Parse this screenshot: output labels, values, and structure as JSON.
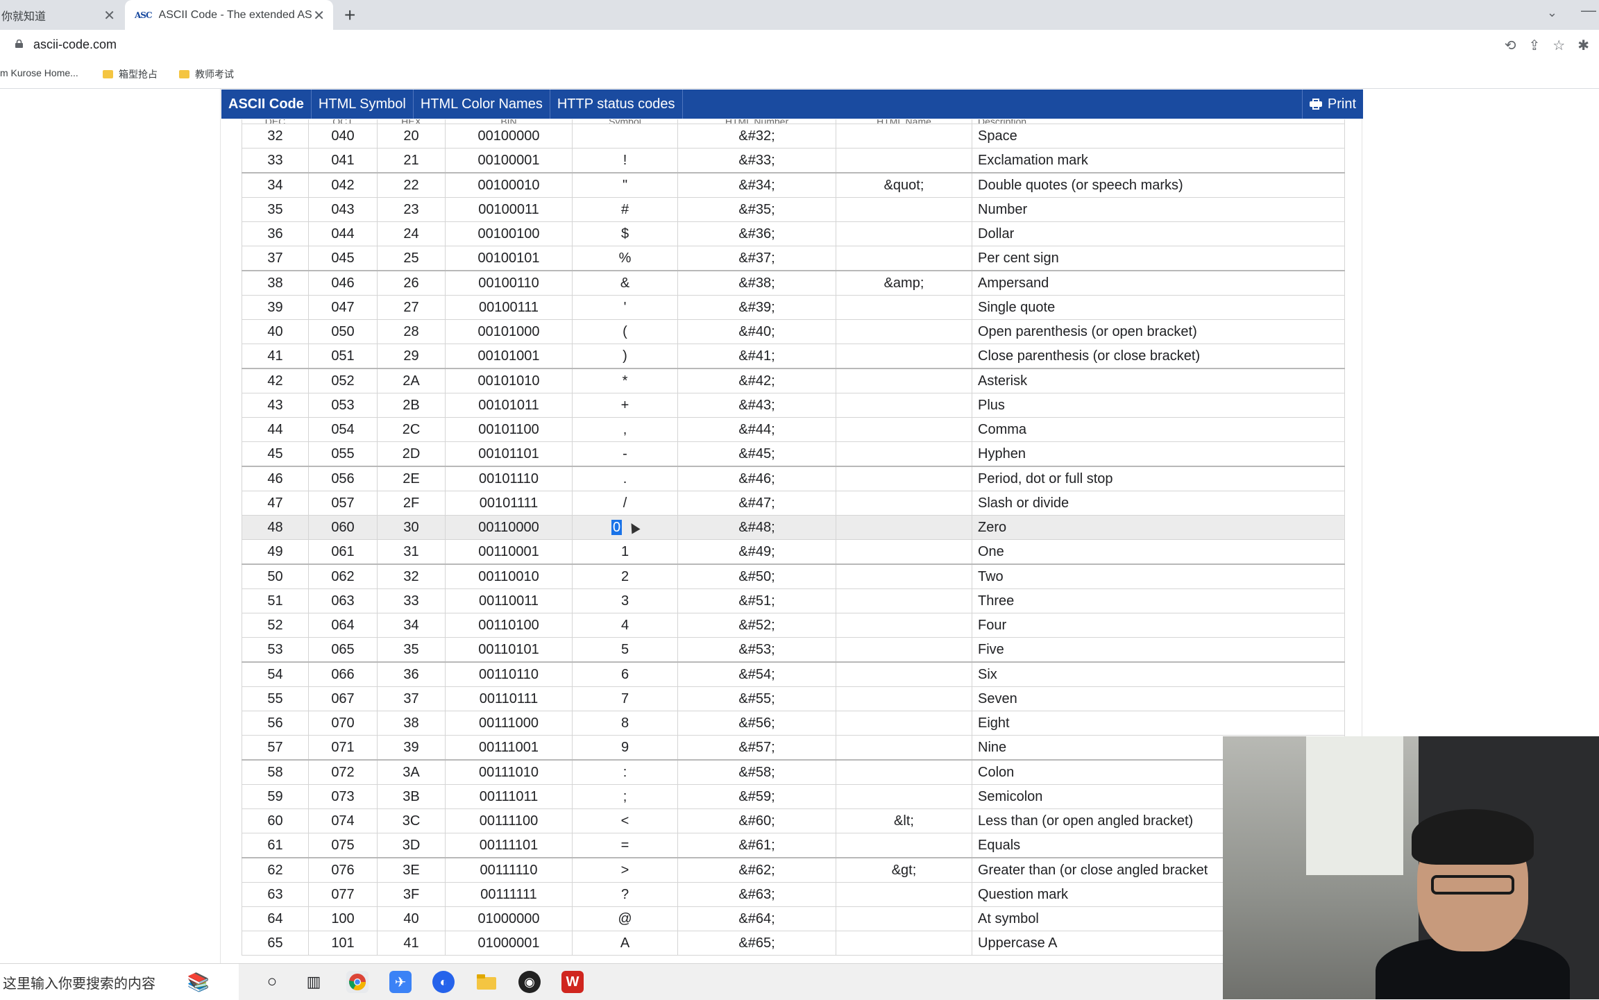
{
  "browser": {
    "tabs": [
      {
        "title": "你就知道",
        "active": false
      },
      {
        "title": "ASCII Code - The extended AS",
        "active": true
      }
    ],
    "favicon_text": "ASC",
    "url": "ascii-code.com",
    "bookmarks": [
      {
        "label": "m Kurose Home..."
      },
      {
        "label": "箱型抢占"
      },
      {
        "label": "教师考试"
      }
    ]
  },
  "site_nav": {
    "brand": "ASCII Code",
    "items": [
      "HTML Symbol",
      "HTML Color Names",
      "HTTP status codes"
    ],
    "print": "Print"
  },
  "table": {
    "header_partial": [
      "DEC",
      "OCT",
      "HEX",
      "BIN",
      "Symbol",
      "HTML Number",
      "HTML Name",
      "Description"
    ],
    "rows": [
      {
        "dec": "32",
        "oct": "040",
        "hex": "20",
        "bin": "00100000",
        "sym": "",
        "num": "&#32;",
        "name": "",
        "desc": "Space"
      },
      {
        "dec": "33",
        "oct": "041",
        "hex": "21",
        "bin": "00100001",
        "sym": "!",
        "num": "&#33;",
        "name": "",
        "desc": "Exclamation mark"
      },
      {
        "dec": "34",
        "oct": "042",
        "hex": "22",
        "bin": "00100010",
        "sym": "\"",
        "num": "&#34;",
        "name": "&quot;",
        "desc": "Double quotes (or speech marks)"
      },
      {
        "dec": "35",
        "oct": "043",
        "hex": "23",
        "bin": "00100011",
        "sym": "#",
        "num": "&#35;",
        "name": "",
        "desc": "Number"
      },
      {
        "dec": "36",
        "oct": "044",
        "hex": "24",
        "bin": "00100100",
        "sym": "$",
        "num": "&#36;",
        "name": "",
        "desc": "Dollar"
      },
      {
        "dec": "37",
        "oct": "045",
        "hex": "25",
        "bin": "00100101",
        "sym": "%",
        "num": "&#37;",
        "name": "",
        "desc": "Per cent sign"
      },
      {
        "dec": "38",
        "oct": "046",
        "hex": "26",
        "bin": "00100110",
        "sym": "&",
        "num": "&#38;",
        "name": "&amp;",
        "desc": "Ampersand"
      },
      {
        "dec": "39",
        "oct": "047",
        "hex": "27",
        "bin": "00100111",
        "sym": "'",
        "num": "&#39;",
        "name": "",
        "desc": "Single quote"
      },
      {
        "dec": "40",
        "oct": "050",
        "hex": "28",
        "bin": "00101000",
        "sym": "(",
        "num": "&#40;",
        "name": "",
        "desc": "Open parenthesis (or open bracket)"
      },
      {
        "dec": "41",
        "oct": "051",
        "hex": "29",
        "bin": "00101001",
        "sym": ")",
        "num": "&#41;",
        "name": "",
        "desc": "Close parenthesis (or close bracket)"
      },
      {
        "dec": "42",
        "oct": "052",
        "hex": "2A",
        "bin": "00101010",
        "sym": "*",
        "num": "&#42;",
        "name": "",
        "desc": "Asterisk"
      },
      {
        "dec": "43",
        "oct": "053",
        "hex": "2B",
        "bin": "00101011",
        "sym": "+",
        "num": "&#43;",
        "name": "",
        "desc": "Plus"
      },
      {
        "dec": "44",
        "oct": "054",
        "hex": "2C",
        "bin": "00101100",
        "sym": ",",
        "num": "&#44;",
        "name": "",
        "desc": "Comma"
      },
      {
        "dec": "45",
        "oct": "055",
        "hex": "2D",
        "bin": "00101101",
        "sym": "-",
        "num": "&#45;",
        "name": "",
        "desc": "Hyphen"
      },
      {
        "dec": "46",
        "oct": "056",
        "hex": "2E",
        "bin": "00101110",
        "sym": ".",
        "num": "&#46;",
        "name": "",
        "desc": "Period, dot or full stop"
      },
      {
        "dec": "47",
        "oct": "057",
        "hex": "2F",
        "bin": "00101111",
        "sym": "/",
        "num": "&#47;",
        "name": "",
        "desc": "Slash or divide"
      },
      {
        "dec": "48",
        "oct": "060",
        "hex": "30",
        "bin": "00110000",
        "sym": "0",
        "num": "&#48;",
        "name": "",
        "desc": "Zero"
      },
      {
        "dec": "49",
        "oct": "061",
        "hex": "31",
        "bin": "00110001",
        "sym": "1",
        "num": "&#49;",
        "name": "",
        "desc": "One"
      },
      {
        "dec": "50",
        "oct": "062",
        "hex": "32",
        "bin": "00110010",
        "sym": "2",
        "num": "&#50;",
        "name": "",
        "desc": "Two"
      },
      {
        "dec": "51",
        "oct": "063",
        "hex": "33",
        "bin": "00110011",
        "sym": "3",
        "num": "&#51;",
        "name": "",
        "desc": "Three"
      },
      {
        "dec": "52",
        "oct": "064",
        "hex": "34",
        "bin": "00110100",
        "sym": "4",
        "num": "&#52;",
        "name": "",
        "desc": "Four"
      },
      {
        "dec": "53",
        "oct": "065",
        "hex": "35",
        "bin": "00110101",
        "sym": "5",
        "num": "&#53;",
        "name": "",
        "desc": "Five"
      },
      {
        "dec": "54",
        "oct": "066",
        "hex": "36",
        "bin": "00110110",
        "sym": "6",
        "num": "&#54;",
        "name": "",
        "desc": "Six"
      },
      {
        "dec": "55",
        "oct": "067",
        "hex": "37",
        "bin": "00110111",
        "sym": "7",
        "num": "&#55;",
        "name": "",
        "desc": "Seven"
      },
      {
        "dec": "56",
        "oct": "070",
        "hex": "38",
        "bin": "00111000",
        "sym": "8",
        "num": "&#56;",
        "name": "",
        "desc": "Eight"
      },
      {
        "dec": "57",
        "oct": "071",
        "hex": "39",
        "bin": "00111001",
        "sym": "9",
        "num": "&#57;",
        "name": "",
        "desc": "Nine"
      },
      {
        "dec": "58",
        "oct": "072",
        "hex": "3A",
        "bin": "00111010",
        "sym": ":",
        "num": "&#58;",
        "name": "",
        "desc": "Colon"
      },
      {
        "dec": "59",
        "oct": "073",
        "hex": "3B",
        "bin": "00111011",
        "sym": ";",
        "num": "&#59;",
        "name": "",
        "desc": "Semicolon"
      },
      {
        "dec": "60",
        "oct": "074",
        "hex": "3C",
        "bin": "00111100",
        "sym": "<",
        "num": "&#60;",
        "name": "&lt;",
        "desc": "Less than (or open angled bracket)"
      },
      {
        "dec": "61",
        "oct": "075",
        "hex": "3D",
        "bin": "00111101",
        "sym": "=",
        "num": "&#61;",
        "name": "",
        "desc": "Equals"
      },
      {
        "dec": "62",
        "oct": "076",
        "hex": "3E",
        "bin": "00111110",
        "sym": ">",
        "num": "&#62;",
        "name": "&gt;",
        "desc": "Greater than (or close angled bracket"
      },
      {
        "dec": "63",
        "oct": "077",
        "hex": "3F",
        "bin": "00111111",
        "sym": "?",
        "num": "&#63;",
        "name": "",
        "desc": "Question mark"
      },
      {
        "dec": "64",
        "oct": "100",
        "hex": "40",
        "bin": "01000000",
        "sym": "@",
        "num": "&#64;",
        "name": "",
        "desc": "At symbol"
      },
      {
        "dec": "65",
        "oct": "101",
        "hex": "41",
        "bin": "01000001",
        "sym": "A",
        "num": "&#65;",
        "name": "",
        "desc": "Uppercase A"
      }
    ],
    "highlighted_dec": "48",
    "group_start_decs": [
      "34",
      "38",
      "42",
      "46",
      "50",
      "54",
      "58",
      "62"
    ]
  },
  "taskbar": {
    "search_placeholder": "这里输入你要搜索的内容"
  },
  "colors": {
    "nav_bg": "#1a4ba0",
    "tabbar_bg": "#dee1e6",
    "row_highlight": "#ececec",
    "selection": "#1a73e8"
  }
}
